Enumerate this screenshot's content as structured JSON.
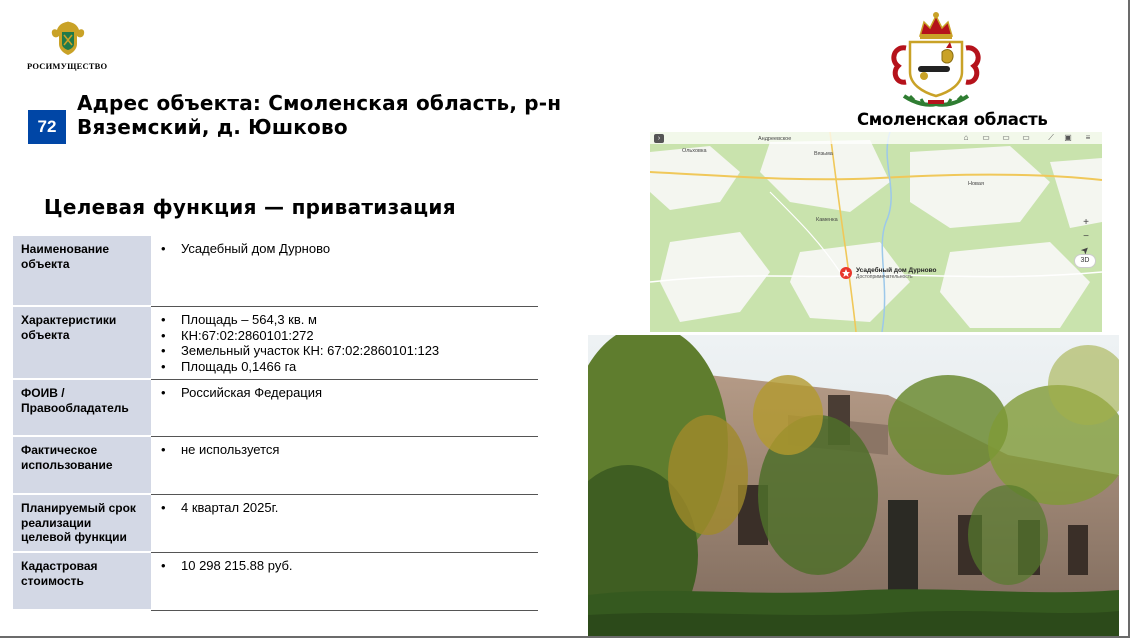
{
  "header": {
    "org_name": "РОСИМУЩЕСТВО",
    "item_number": "72",
    "title_line1": "Адрес объекта: Смоленская область, р-н",
    "title_line2": "Вяземский, д. Юшково",
    "subtitle": "Целевая функция — приватизация",
    "region_name": "Смоленская область"
  },
  "table": {
    "rows": [
      {
        "label": "Наименование объекта",
        "values": [
          "Усадебный дом Дурново"
        ]
      },
      {
        "label": "Характеристики объекта",
        "values": [
          "Площадь – 564,3 кв. м",
          "КН:67:02:2860101:272",
          "Земельный участок КН: 67:02:2860101:123",
          "Площадь 0,1466  га"
        ]
      },
      {
        "label": "ФОИВ / Правообладатель",
        "values": [
          "Российская Федерация"
        ]
      },
      {
        "label": "Фактическое использование",
        "values": [
          "не используется"
        ]
      },
      {
        "label": "Планируемый срок реализации целевой функции",
        "values": [
          "4 квартал 2025г."
        ]
      },
      {
        "label": "Кадастровая стоимость",
        "values": [
          "10 298 215.88 руб."
        ]
      }
    ]
  },
  "map": {
    "poi_label": "Усадебный дом Дурново",
    "poi_sublabel": "Достопримечательность",
    "zoom_in": "+",
    "zoom_out": "−",
    "compass": "➤",
    "scale_label": "3D",
    "towns": [
      "Вязьма",
      "Андреевское",
      "Ольховка",
      "Новая",
      "Каменка"
    ]
  },
  "colors": {
    "badge": "#0046a6",
    "table_label_bg": "#d3d8e5",
    "map_green": "#c9e3ad",
    "map_white": "#f4f6f0",
    "poi_red": "#e8362b"
  }
}
